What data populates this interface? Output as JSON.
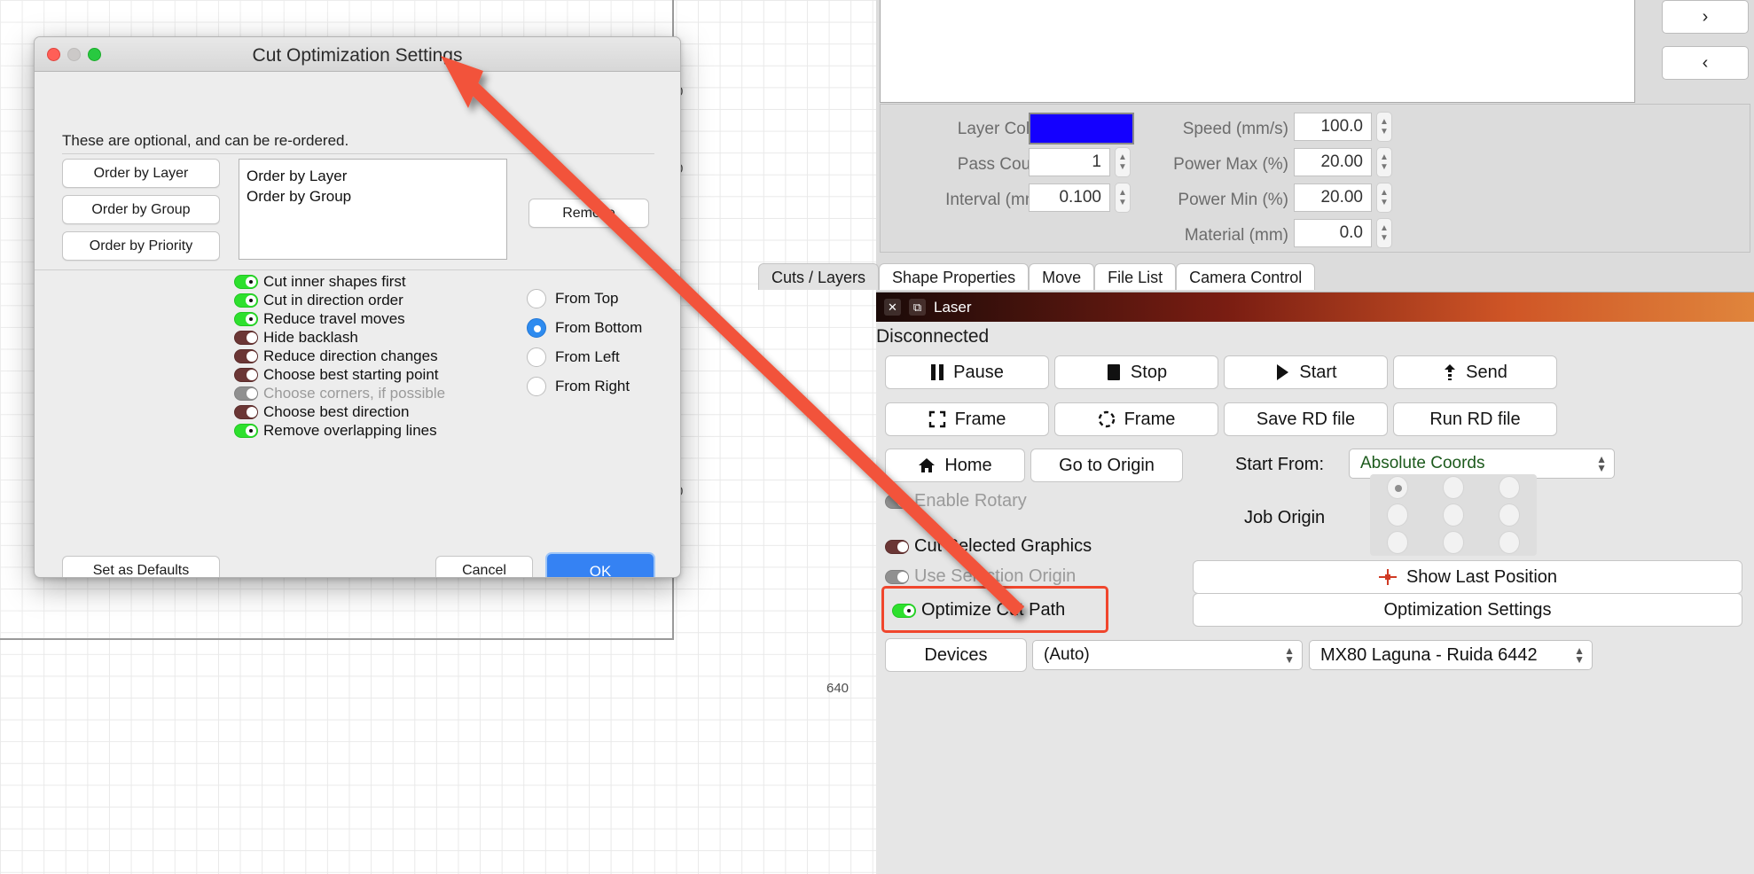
{
  "dialog": {
    "title": "Cut Optimization Settings",
    "hint": "These are optional, and can be re-ordered.",
    "order_buttons": [
      {
        "label": "Order by Layer"
      },
      {
        "label": "Order by Group"
      },
      {
        "label": "Order by Priority"
      }
    ],
    "order_list": [
      "Order by Layer",
      "Order by Group"
    ],
    "remove_label": "Remove",
    "toggles": [
      {
        "label": "Cut inner shapes first",
        "state": "on"
      },
      {
        "label": "Cut in direction order",
        "state": "on"
      },
      {
        "label": "Reduce travel moves",
        "state": "on"
      },
      {
        "label": "Hide backlash",
        "state": "off"
      },
      {
        "label": "Reduce direction changes",
        "state": "off"
      },
      {
        "label": "Choose best starting point",
        "state": "off"
      },
      {
        "label": "Choose corners, if possible",
        "state": "disabled"
      },
      {
        "label": "Choose best direction",
        "state": "off"
      },
      {
        "label": "Remove overlapping lines",
        "state": "on"
      }
    ],
    "direction_options": [
      {
        "label": "From Top",
        "selected": false
      },
      {
        "label": "From Bottom",
        "selected": true
      },
      {
        "label": "From Left",
        "selected": false
      },
      {
        "label": "From Right",
        "selected": false
      }
    ],
    "set_defaults_label": "Set as Defaults",
    "cancel_label": "Cancel",
    "ok_label": "OK"
  },
  "canvas": {
    "ruler_labels": [
      "0",
      "0",
      "0",
      "640"
    ]
  },
  "right_panel": {
    "nav_next": "›",
    "nav_prev": "‹",
    "layer": {
      "layer_color_label": "Layer Color",
      "layer_color_value": "#1400ff",
      "pass_count_label": "Pass Count",
      "pass_count_value": "1",
      "interval_label": "Interval (mm)",
      "interval_value": "0.100",
      "speed_label": "Speed (mm/s)",
      "speed_value": "100.0",
      "power_max_label": "Power Max (%)",
      "power_max_value": "20.00",
      "power_min_label": "Power Min (%)",
      "power_min_value": "20.00",
      "material_label": "Material (mm)",
      "material_value": "0.0"
    },
    "tabs": [
      {
        "label": "Cuts / Layers",
        "active": true
      },
      {
        "label": "Shape Properties",
        "active": false
      },
      {
        "label": "Move",
        "active": false
      },
      {
        "label": "File List",
        "active": false
      },
      {
        "label": "Camera Control",
        "active": false
      }
    ]
  },
  "laser": {
    "window_title": "Laser",
    "close_glyph": "✕",
    "restore_glyph": "⧉",
    "status": "Disconnected",
    "row1": [
      {
        "label": "Pause",
        "icon": "pause-icon"
      },
      {
        "label": "Stop",
        "icon": "stop-icon"
      },
      {
        "label": "Start",
        "icon": "play-icon"
      },
      {
        "label": "Send",
        "icon": "upload-icon"
      }
    ],
    "row2": [
      {
        "label": "Frame",
        "icon": "frame-square-icon"
      },
      {
        "label": "Frame",
        "icon": "frame-round-icon"
      },
      {
        "label": "Save RD file",
        "icon": ""
      },
      {
        "label": "Run RD file",
        "icon": ""
      }
    ],
    "home_label": "Home",
    "go_to_origin_label": "Go to Origin",
    "start_from_label": "Start From:",
    "start_from_value": "Absolute Coords",
    "job_origin_label": "Job Origin",
    "job_origin_selected_index": 0,
    "enable_rotary": {
      "label": "Enable Rotary",
      "state": "disabled"
    },
    "cut_selected_graphics": {
      "label": "Cut Selected Graphics",
      "state": "off"
    },
    "use_selection_origin": {
      "label": "Use Selection Origin",
      "state": "disabled"
    },
    "optimize_cut_path": {
      "label": "Optimize Cut Path",
      "state": "on"
    },
    "show_last_position_label": "Show Last Position",
    "optimization_settings_label": "Optimization Settings",
    "devices_label": "Devices",
    "device_auto_value": "(Auto)",
    "device_name_value": "MX80 Laguna - Ruida 6442",
    "highlight_color": "#f0462d"
  }
}
